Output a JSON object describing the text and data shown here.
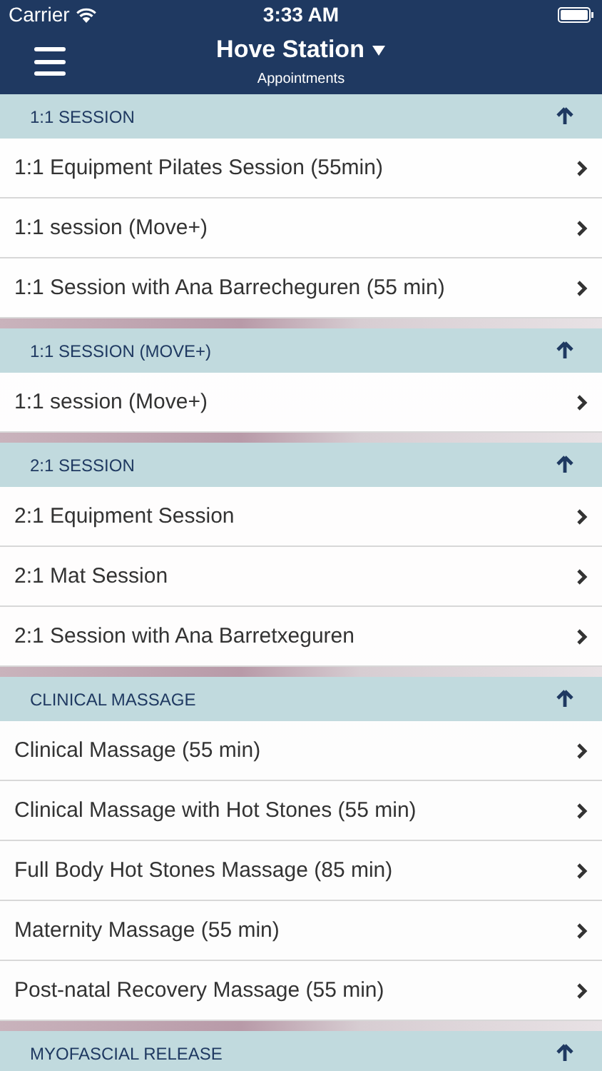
{
  "status_bar": {
    "carrier": "Carrier",
    "time": "3:33 AM"
  },
  "nav": {
    "title": "Hove Station",
    "subtitle": "Appointments"
  },
  "sections": [
    {
      "title": "1:1 SESSION",
      "expanded": true,
      "items": [
        "1:1 Equipment Pilates Session (55min)",
        "1:1 session (Move+)",
        "1:1 Session with Ana Barrecheguren (55 min)"
      ]
    },
    {
      "title": "1:1 SESSION (MOVE+)",
      "expanded": true,
      "items": [
        "1:1 session (Move+)"
      ]
    },
    {
      "title": "2:1 SESSION",
      "expanded": true,
      "items": [
        "2:1 Equipment Session",
        "2:1 Mat Session",
        "2:1 Session with Ana Barretxeguren"
      ]
    },
    {
      "title": "CLINICAL MASSAGE",
      "expanded": true,
      "items": [
        "Clinical Massage (55 min)",
        "Clinical Massage with Hot Stones (55 min)",
        "Full Body Hot Stones Massage (85 min)",
        "Maternity Massage (55 min)",
        "Post-natal Recovery Massage (55 min)"
      ]
    },
    {
      "title": "MYOFASCIAL RELEASE",
      "expanded": true
    }
  ]
}
